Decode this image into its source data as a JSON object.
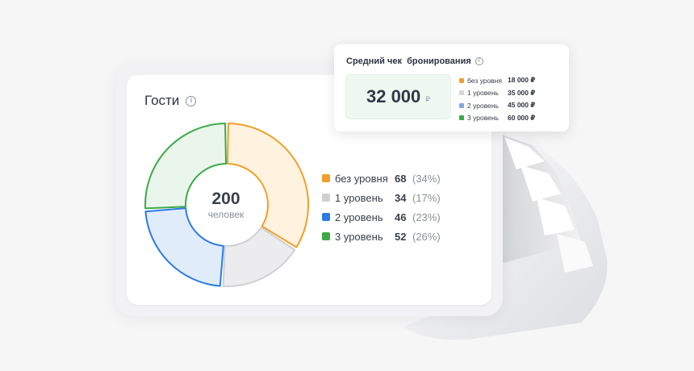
{
  "guests_card": {
    "title": "Гости",
    "center_value": "200",
    "center_label": "человек"
  },
  "chart_data": {
    "type": "pie",
    "donut": true,
    "total": 200,
    "categories": [
      "без уровня",
      "1 уровень",
      "2 уровень",
      "3 уровень"
    ],
    "values": [
      68,
      34,
      46,
      52
    ],
    "percent_labels": [
      "(34%)",
      "(17%)",
      "(23%)",
      "(26%)"
    ],
    "colors": [
      "#f0a02a",
      "#cfd0d4",
      "#2c7be5",
      "#3caa48"
    ],
    "fill_colors": [
      "#fff3e0",
      "#ececee",
      "#e1ecfb",
      "#eaf6ec"
    ],
    "order": "clockwise from top"
  },
  "legend": [
    {
      "label": "без уровня",
      "count": "68",
      "pct": "(34%)",
      "color": "#f0a02a"
    },
    {
      "label": "1 уровень",
      "count": "34",
      "pct": "(17%)",
      "color": "#cfd0d4"
    },
    {
      "label": "2 уровень",
      "count": "46",
      "pct": "(23%)",
      "color": "#2c7be5"
    },
    {
      "label": "3 уровень",
      "count": "52",
      "pct": "(26%)",
      "color": "#3caa48"
    }
  ],
  "booking_card": {
    "title": "Средний чек  бронирования",
    "value": "32 000",
    "currency": "₽",
    "items": [
      {
        "label": "без уровня",
        "amount": "18 000 ₽",
        "color": "#f0a02a"
      },
      {
        "label": "1 уровень",
        "amount": "35 000 ₽",
        "color": "#d6d7db"
      },
      {
        "label": "2 уровень",
        "amount": "45 000 ₽",
        "color": "#7fa9e8"
      },
      {
        "label": "3 уровень",
        "amount": "60 000 ₽",
        "color": "#3caa48"
      }
    ]
  }
}
